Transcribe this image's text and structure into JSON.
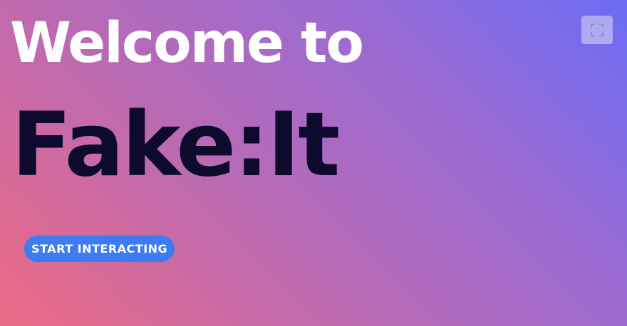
{
  "hero": {
    "welcome_text": "Welcome to",
    "brand_name": "Fake:It",
    "start_button_label": "START INTERACTING"
  },
  "controls": {
    "fullscreen_icon": "fullscreen-icon"
  },
  "colors": {
    "gradient_start": "#ec6b84",
    "gradient_end": "#6b6cf4",
    "welcome_text": "#ffffff",
    "brand_text": "#0d0a2e",
    "button_bg": "#3d7cf0"
  }
}
